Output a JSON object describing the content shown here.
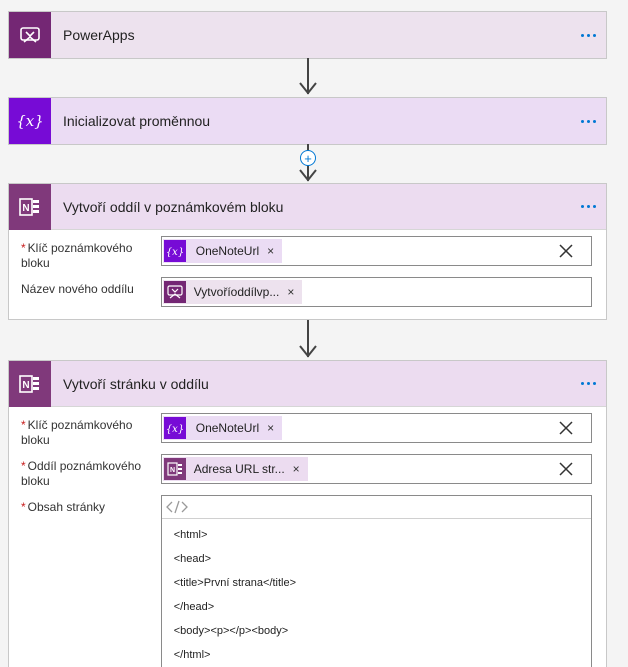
{
  "steps": [
    {
      "title": "PowerApps",
      "icon": "powerapps-icon"
    },
    {
      "title": "Inicializovat proměnnou",
      "icon": "variable-icon"
    },
    {
      "title": "Vytvoří oddíl v poznámkovém bloku",
      "icon": "onenote-icon",
      "fields": [
        {
          "label": "Klíč poznámkového bloku",
          "required": "*",
          "token": "OneNoteUrl"
        },
        {
          "label": "Název nového oddílu",
          "token": "Vytvoříoddílvp..."
        }
      ]
    },
    {
      "title": "Vytvoří stránku v oddílu",
      "icon": "onenote-icon",
      "fields": [
        {
          "label": "Klíč poznámkového bloku",
          "required": "*",
          "token": "OneNoteUrl"
        },
        {
          "label": "Oddíl poznámkového bloku",
          "required": "*",
          "token": "Adresa URL str..."
        },
        {
          "label": "Obsah stránky",
          "required": "*"
        }
      ],
      "editor_lines": [
        "<html>",
        "<head>",
        "<title>První strana</title>",
        "</head>",
        "<body><p></p><body>",
        "</html>"
      ]
    }
  ],
  "token_remove_glyph": "×",
  "add_step_glyph": "+",
  "colors": {
    "powerapps": "#742774",
    "variable": "#770bd6",
    "onenote": "#80397b",
    "accent": "#0078d4",
    "required": "#c81e1e"
  }
}
